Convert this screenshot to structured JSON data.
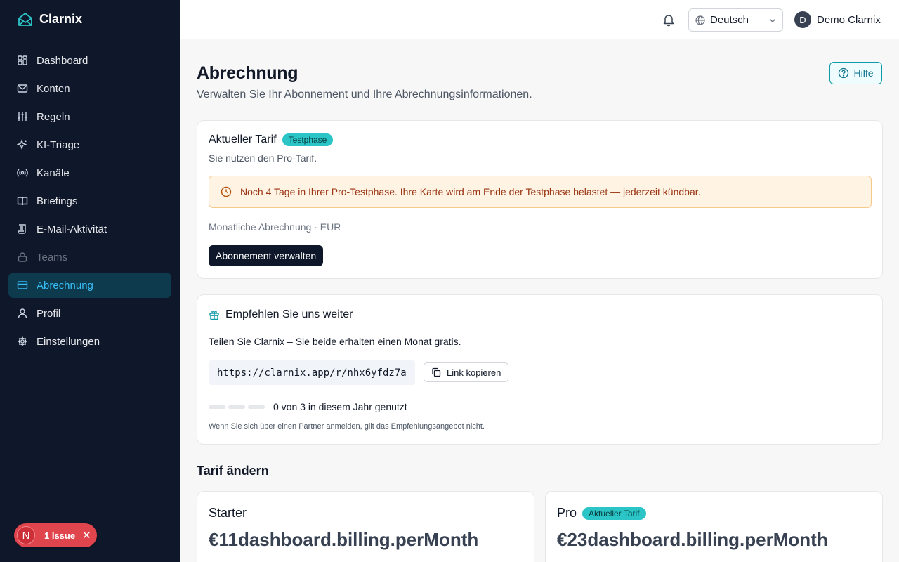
{
  "brand": {
    "name": "Clarnix"
  },
  "sidebar": {
    "items": [
      {
        "label": "Dashboard",
        "icon": "dashboard-icon"
      },
      {
        "label": "Konten",
        "icon": "mail-icon"
      },
      {
        "label": "Regeln",
        "icon": "sliders-icon"
      },
      {
        "label": "KI-Triage",
        "icon": "sparkles-icon"
      },
      {
        "label": "Kanäle",
        "icon": "broadcast-icon"
      },
      {
        "label": "Briefings",
        "icon": "book-icon"
      },
      {
        "label": "E-Mail-Aktivität",
        "icon": "scroll-icon"
      },
      {
        "label": "Teams",
        "icon": "lock-icon",
        "disabled": true
      },
      {
        "label": "Abrechnung",
        "icon": "credit-card-icon",
        "active": true
      },
      {
        "label": "Profil",
        "icon": "user-icon"
      },
      {
        "label": "Einstellungen",
        "icon": "gear-icon"
      }
    ]
  },
  "issue": {
    "letter": "N",
    "label": "1 Issue"
  },
  "topbar": {
    "language": "Deutsch",
    "user": {
      "initial": "D",
      "name": "Demo Clarnix"
    }
  },
  "page": {
    "title": "Abrechnung",
    "subtitle": "Verwalten Sie Ihr Abonnement und Ihre Abrechnungsinformationen.",
    "help_label": "Hilfe"
  },
  "current_plan": {
    "title": "Aktueller Tarif",
    "badge": "Testphase",
    "description": "Sie nutzen den Pro-Tarif.",
    "alert": "Noch 4 Tage in Ihrer Pro-Testphase. Ihre Karte wird am Ende der Testphase belastet — jederzeit kündbar.",
    "billing_info": "Monatliche Abrechnung · EUR",
    "manage_label": "Abonnement verwalten"
  },
  "referral": {
    "title": "Empfehlen Sie uns weiter",
    "intro": "Teilen Sie Clarnix – Sie beide erhalten einen Monat gratis.",
    "link": "https://clarnix.app/r/nhx6yfdz7a",
    "copy_label": "Link kopieren",
    "used": 0,
    "total": 3,
    "progress_text": "0 von 3 in diesem Jahr genutzt",
    "note": "Wenn Sie sich über einen Partner anmelden, gilt das Empfehlungsangebot nicht."
  },
  "change_plan": {
    "title": "Tarif ändern",
    "plans": [
      {
        "name": "Starter",
        "price": "€11dashboard.billing.perMonth"
      },
      {
        "name": "Pro",
        "badge": "Aktueller Tarif",
        "price": "€23dashboard.billing.perMonth"
      }
    ]
  },
  "colors": {
    "sidebar_bg": "#0f172a",
    "accent": "#2cc5c7",
    "active_text": "#38bdf8",
    "alert_bg": "#fff3e4",
    "issue_red": "#e0454d"
  }
}
